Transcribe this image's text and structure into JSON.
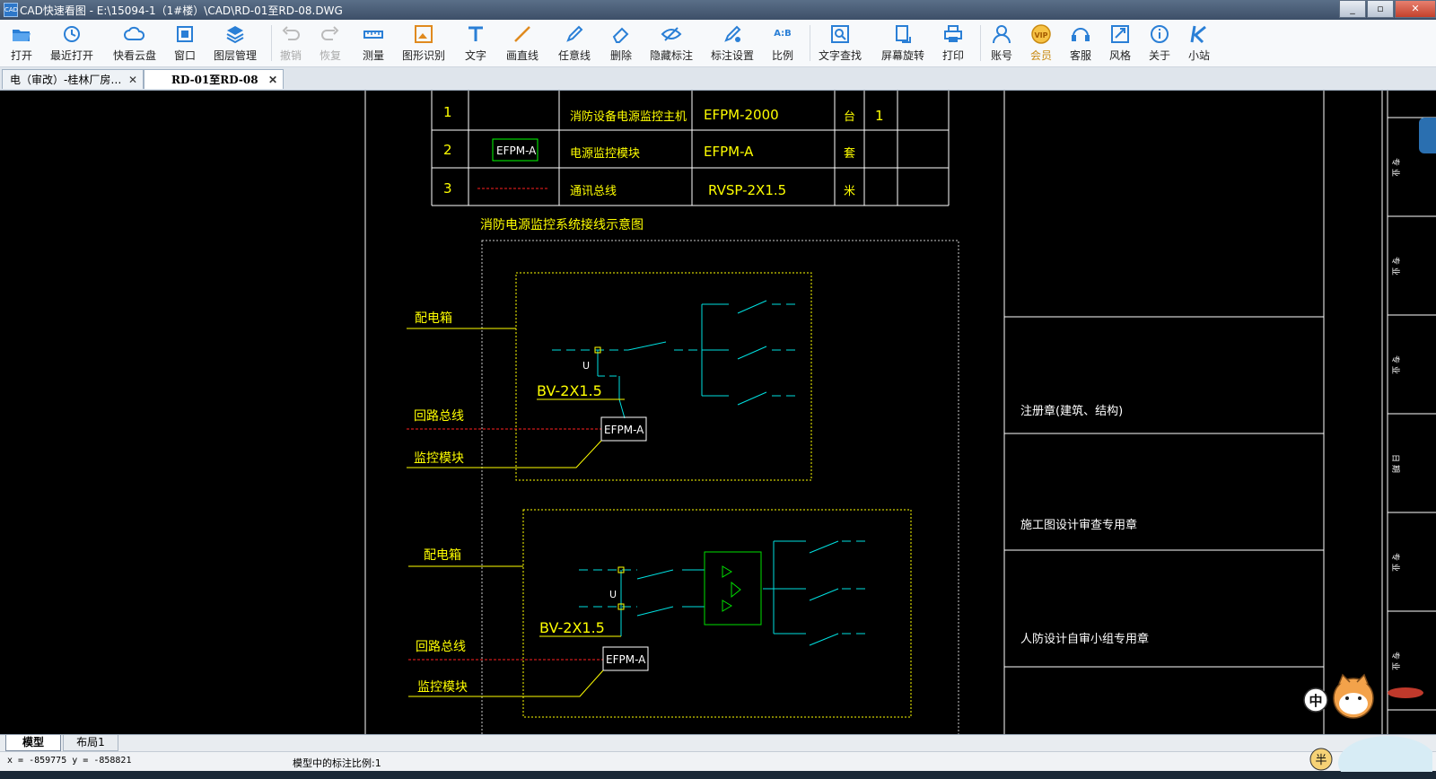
{
  "window": {
    "app_icon_text": "CAD",
    "title": "CAD快速看图 - E:\\15094-1（1#楼）\\CAD\\RD-01至RD-08.DWG",
    "minimize": "_",
    "maximize": "▫",
    "close": "✕"
  },
  "toolbar": {
    "items": [
      {
        "label": "打开",
        "icon": "folder-open-icon"
      },
      {
        "label": "最近打开",
        "icon": "clock-icon"
      },
      {
        "label": "快看云盘",
        "icon": "cloud-icon"
      },
      {
        "label": "窗口",
        "icon": "window-icon"
      },
      {
        "label": "图层管理",
        "icon": "layers-icon"
      },
      {
        "label": "撤销",
        "icon": "undo-icon",
        "disabled": true
      },
      {
        "label": "恢复",
        "icon": "redo-icon",
        "disabled": true
      },
      {
        "label": "测量",
        "icon": "ruler-icon"
      },
      {
        "label": "图形识别",
        "icon": "shape-recognize-icon"
      },
      {
        "label": "文字",
        "icon": "text-icon"
      },
      {
        "label": "画直线",
        "icon": "line-icon"
      },
      {
        "label": "任意线",
        "icon": "pen-icon"
      },
      {
        "label": "删除",
        "icon": "eraser-icon"
      },
      {
        "label": "隐藏标注",
        "icon": "eye-hide-icon"
      },
      {
        "label": "标注设置",
        "icon": "annotation-settings-icon"
      },
      {
        "label": "比例",
        "icon": "ratio-icon"
      },
      {
        "label": "文字查找",
        "icon": "text-search-icon"
      },
      {
        "label": "屏幕旋转",
        "icon": "rotate-icon"
      },
      {
        "label": "打印",
        "icon": "printer-icon"
      },
      {
        "label": "账号",
        "icon": "user-icon"
      },
      {
        "label": "会员",
        "icon": "vip-icon",
        "vip": true
      },
      {
        "label": "客服",
        "icon": "headset-icon"
      },
      {
        "label": "风格",
        "icon": "style-icon"
      },
      {
        "label": "关于",
        "icon": "info-icon"
      },
      {
        "label": "小站",
        "icon": "k-logo-icon"
      }
    ],
    "vip_badge_text": "VIP",
    "ratio_icon_text": "A:B"
  },
  "tabs": [
    {
      "label": "电（审改）-桂林厂房…",
      "close": "✕",
      "active": false
    },
    {
      "label": "RD-01至RD-08",
      "close": "✕",
      "active": true
    }
  ],
  "drawing": {
    "legend_table": {
      "rows": [
        {
          "num": "1",
          "symbol": "",
          "name": "消防设备电源监控主机",
          "model": "EFPM-2000",
          "unit": "台",
          "qty": "1"
        },
        {
          "num": "2",
          "symbol": "EFPM-A",
          "name": "电源监控模块",
          "model": "EFPM-A",
          "unit": "套",
          "qty": ""
        },
        {
          "num": "3",
          "symbol": "",
          "name": "通讯总线",
          "model": "RVSP-2X1.5",
          "unit": "米",
          "qty": ""
        }
      ]
    },
    "diagram_title": "消防电源监控系统接线示意图",
    "diagram1": {
      "dist_box": "配电箱",
      "voltage": "U",
      "wire": "BV-2X1.5",
      "bus": "回路总线",
      "module_label": "监控模块",
      "module": "EFPM-A"
    },
    "diagram2": {
      "dist_box": "配电箱",
      "voltage": "U",
      "wire": "BV-2X1.5",
      "bus": "回路总线",
      "module_label": "监控模块",
      "module": "EFPM-A"
    },
    "title_block": {
      "stamp1": "注册章(建筑、结构)",
      "stamp2": "施工图设计审查专用章",
      "stamp3": "人防设计自审小组专用章"
    }
  },
  "layout_tabs": {
    "model": "模型",
    "layout1": "布局1"
  },
  "status": {
    "coords": "x = -859775  y = -858821",
    "annotation_scale": "模型中的标注比例:1"
  },
  "ime": {
    "mode": "中",
    "badge": "半"
  }
}
